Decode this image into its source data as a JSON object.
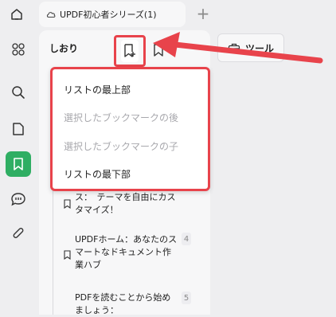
{
  "tabbar": {
    "tab_title": "UPDF初心者シリーズ(1)",
    "new_tab_label": "+"
  },
  "bookmark_panel": {
    "title": "しおり",
    "add_menu": {
      "items": [
        {
          "label": "リストの最上部",
          "enabled": true
        },
        {
          "label": "選択したブックマークの後",
          "enabled": false
        },
        {
          "label": "選択したブックマークの子",
          "enabled": false
        },
        {
          "label": "リストの最下部",
          "enabled": true
        }
      ]
    },
    "list": [
      {
        "text": "ス：　テーマを自由にカスタマイズ！",
        "page": ""
      },
      {
        "text": "UPDFホーム：あなたのスマートなドキュメント作業ハブ",
        "page": "4"
      },
      {
        "text": "PDFを読むことから始めましょう：",
        "page": "5"
      }
    ]
  },
  "toolbar": {
    "tool_label": "ツール"
  },
  "colors": {
    "accent_green": "#2fae63",
    "highlight_red": "#e8434b"
  },
  "icons": {
    "home": "home-icon",
    "cloud": "cloud-icon",
    "apps": "apps-grid-icon",
    "search": "search-icon",
    "page": "page-icon",
    "bookmark": "bookmark-icon",
    "comment": "comment-icon",
    "attachment": "paperclip-icon",
    "add_bookmark": "add-bookmark-icon",
    "toolbox": "toolbox-icon"
  }
}
